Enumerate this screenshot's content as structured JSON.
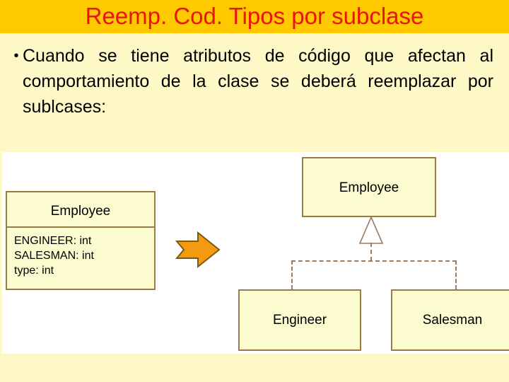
{
  "slide": {
    "title": "Reemp. Cod. Tipos por subclase",
    "title_color": "#e8140e",
    "title_bar_color": "#ffc900",
    "background_color": "#fdf8c6",
    "body_background_color": "#fdf8c6",
    "diagram_background_color": "#ffffff"
  },
  "body": {
    "bullet_marker": "•",
    "bullet_text": "Cuando se tiene atributos de código que afectan al comportamiento de la clase se deberá reemplazar por sublcases:"
  },
  "diagram": {
    "box_fill_color": "#fcfbd0",
    "box_border_color": "#9a7b45",
    "connector_color": "#9b7a60",
    "arrow_color": "#f39a10",
    "before": {
      "class_name": "Employee",
      "attributes": "ENGINEER: int\nSALESMAN: int\ntype: int",
      "attribute_lines": [
        "ENGINEER: int",
        "SALESMAN: int",
        "type: int"
      ]
    },
    "transform_arrow_label": "refactor-arrow",
    "after": {
      "superclass": "Employee",
      "subclasses": [
        "Engineer",
        "Salesman"
      ]
    }
  }
}
